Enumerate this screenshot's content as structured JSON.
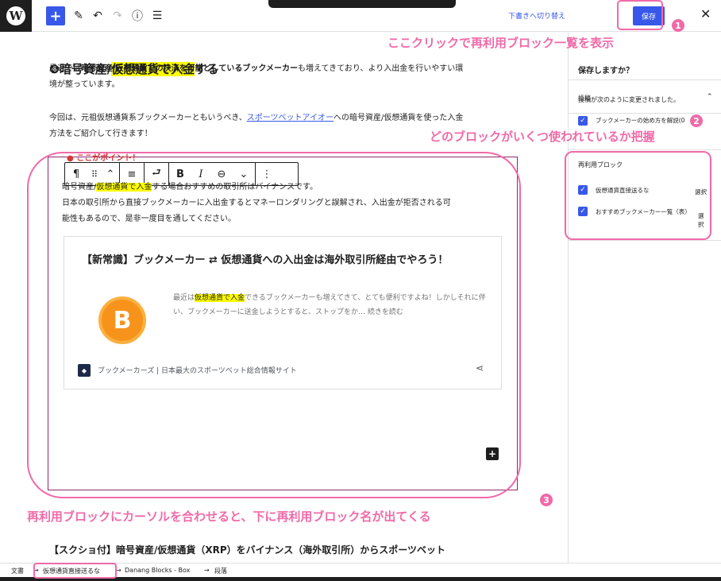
{
  "toolbar": {
    "draft_switch": "下書きへ切り替え",
    "save_label": "保存"
  },
  "editor": {
    "heading": {
      "prefix": "❹暗号資産/",
      "highlight": "仮想通貨で入金",
      "suffix": "する"
    },
    "para1": {
      "l1_pre": "最近では",
      "l1_bold": "暗号資産/仮想通貨での決済を可能としているブックメーカー",
      "l1_post": "も増えてきており、より入出金を行いやすい環",
      "l2": "境が整っています。"
    },
    "para2": {
      "l1_pre": "今回は、元祖仮想通貨系ブックメーカーともいうべき、",
      "l1_link": "スポーツベットアイオー",
      "l1_post": "への暗号資産/仮想通貨を使った入金",
      "l2": "方法をご紹介して行きます！"
    },
    "point_label": "● ここがポイント！",
    "block_line1_pre": "暗号資産/",
    "block_line1_hl": "仮想通貨で入金",
    "block_line1_post": "する場合おすすめの取引所はバイナンスです。",
    "block_line2": "日本の取引所から直接ブックメーカーに入出金するとマネーロンダリングと誤解され、入出金が拒否される可",
    "block_line3": "能性もあるので、是非一度目を通してください。",
    "card": {
      "title": "【新常識】ブックメーカー ⇄ 仮想通貨への入出金は海外取引所経由でやろう！",
      "excerpt_pre": "最近は",
      "excerpt_hl": "仮想通貨で入金",
      "excerpt_post": "できるブックメーカーも増えてきて、とても便利ですよね！しかしそれに伴い、ブックメーカーに送金しようとすると、ストップをか…",
      "read_more": "続きを読む",
      "coin_symbol": "B",
      "site": "ブックメーカーズ | 日本最大のスポーツベット総合情報サイト"
    },
    "after_block": "…",
    "bottom_heading": "【スクショ付】暗号資産/仮想通貨（XRP）をバイナンス（海外取引所）からスポーツベット"
  },
  "block_toolbar": {
    "paragraph_icon": "¶",
    "drag_icon": "⠿",
    "move_icon": "⌃",
    "align_icon": "≡",
    "reuse_icon": "⮐",
    "bold_icon": "B",
    "italic_icon": "I",
    "link_icon": "⊖",
    "more_rich_icon": "⌄",
    "options_icon": "⋮"
  },
  "sidebar": {
    "save_title": "保存しますか？",
    "changed_text": "投稿が次のように変更されました。",
    "section_post": "投稿",
    "post_item": "ブックメーカーの始め方を解説",
    "post_item_tail": "(0",
    "section_reusable": "再利用ブロック",
    "reusable_items": [
      {
        "label": "仮想通貨直接送るな",
        "action": "選択"
      },
      {
        "label": "おすすめブックメーカー一覧（表）",
        "action": "選択"
      }
    ]
  },
  "breadcrumb": {
    "items": [
      "文書",
      "仮想通貨直接送るな",
      "Danang Blocks - Box",
      "段落"
    ],
    "sep": "→"
  },
  "annotations": {
    "one_text": "ここクリックで再利用ブロック一覧を表示",
    "two_text": "どのブロックがいくつ使われているか把握",
    "three_text": "再利用ブロックにカーソルを合わせると、下に再利用ブロック名が出てくる",
    "one_num": "1",
    "two_num": "2",
    "three_num": "3"
  },
  "colors": {
    "accent": "#3858e9",
    "annotation": "#f06aa8",
    "highlight": "#ffff00",
    "block_outline": "#8a2c6a"
  }
}
